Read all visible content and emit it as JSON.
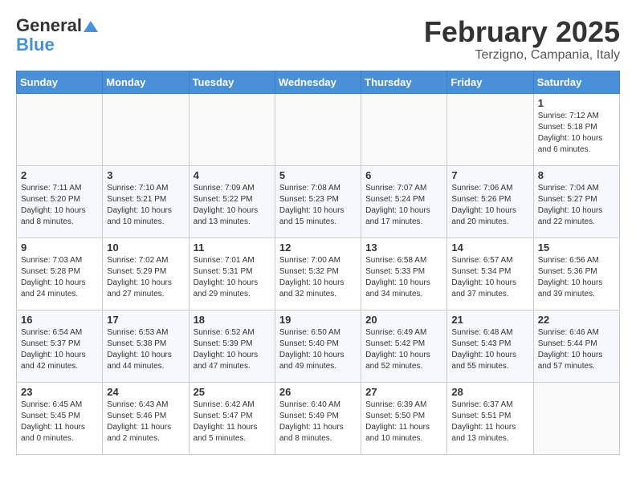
{
  "header": {
    "logo_line1": "General",
    "logo_line2": "Blue",
    "month": "February 2025",
    "location": "Terzigno, Campania, Italy"
  },
  "days_of_week": [
    "Sunday",
    "Monday",
    "Tuesday",
    "Wednesday",
    "Thursday",
    "Friday",
    "Saturday"
  ],
  "weeks": [
    [
      {
        "day": "",
        "info": ""
      },
      {
        "day": "",
        "info": ""
      },
      {
        "day": "",
        "info": ""
      },
      {
        "day": "",
        "info": ""
      },
      {
        "day": "",
        "info": ""
      },
      {
        "day": "",
        "info": ""
      },
      {
        "day": "1",
        "info": "Sunrise: 7:12 AM\nSunset: 5:18 PM\nDaylight: 10 hours and 6 minutes."
      }
    ],
    [
      {
        "day": "2",
        "info": "Sunrise: 7:11 AM\nSunset: 5:20 PM\nDaylight: 10 hours and 8 minutes."
      },
      {
        "day": "3",
        "info": "Sunrise: 7:10 AM\nSunset: 5:21 PM\nDaylight: 10 hours and 10 minutes."
      },
      {
        "day": "4",
        "info": "Sunrise: 7:09 AM\nSunset: 5:22 PM\nDaylight: 10 hours and 13 minutes."
      },
      {
        "day": "5",
        "info": "Sunrise: 7:08 AM\nSunset: 5:23 PM\nDaylight: 10 hours and 15 minutes."
      },
      {
        "day": "6",
        "info": "Sunrise: 7:07 AM\nSunset: 5:24 PM\nDaylight: 10 hours and 17 minutes."
      },
      {
        "day": "7",
        "info": "Sunrise: 7:06 AM\nSunset: 5:26 PM\nDaylight: 10 hours and 20 minutes."
      },
      {
        "day": "8",
        "info": "Sunrise: 7:04 AM\nSunset: 5:27 PM\nDaylight: 10 hours and 22 minutes."
      }
    ],
    [
      {
        "day": "9",
        "info": "Sunrise: 7:03 AM\nSunset: 5:28 PM\nDaylight: 10 hours and 24 minutes."
      },
      {
        "day": "10",
        "info": "Sunrise: 7:02 AM\nSunset: 5:29 PM\nDaylight: 10 hours and 27 minutes."
      },
      {
        "day": "11",
        "info": "Sunrise: 7:01 AM\nSunset: 5:31 PM\nDaylight: 10 hours and 29 minutes."
      },
      {
        "day": "12",
        "info": "Sunrise: 7:00 AM\nSunset: 5:32 PM\nDaylight: 10 hours and 32 minutes."
      },
      {
        "day": "13",
        "info": "Sunrise: 6:58 AM\nSunset: 5:33 PM\nDaylight: 10 hours and 34 minutes."
      },
      {
        "day": "14",
        "info": "Sunrise: 6:57 AM\nSunset: 5:34 PM\nDaylight: 10 hours and 37 minutes."
      },
      {
        "day": "15",
        "info": "Sunrise: 6:56 AM\nSunset: 5:36 PM\nDaylight: 10 hours and 39 minutes."
      }
    ],
    [
      {
        "day": "16",
        "info": "Sunrise: 6:54 AM\nSunset: 5:37 PM\nDaylight: 10 hours and 42 minutes."
      },
      {
        "day": "17",
        "info": "Sunrise: 6:53 AM\nSunset: 5:38 PM\nDaylight: 10 hours and 44 minutes."
      },
      {
        "day": "18",
        "info": "Sunrise: 6:52 AM\nSunset: 5:39 PM\nDaylight: 10 hours and 47 minutes."
      },
      {
        "day": "19",
        "info": "Sunrise: 6:50 AM\nSunset: 5:40 PM\nDaylight: 10 hours and 49 minutes."
      },
      {
        "day": "20",
        "info": "Sunrise: 6:49 AM\nSunset: 5:42 PM\nDaylight: 10 hours and 52 minutes."
      },
      {
        "day": "21",
        "info": "Sunrise: 6:48 AM\nSunset: 5:43 PM\nDaylight: 10 hours and 55 minutes."
      },
      {
        "day": "22",
        "info": "Sunrise: 6:46 AM\nSunset: 5:44 PM\nDaylight: 10 hours and 57 minutes."
      }
    ],
    [
      {
        "day": "23",
        "info": "Sunrise: 6:45 AM\nSunset: 5:45 PM\nDaylight: 11 hours and 0 minutes."
      },
      {
        "day": "24",
        "info": "Sunrise: 6:43 AM\nSunset: 5:46 PM\nDaylight: 11 hours and 2 minutes."
      },
      {
        "day": "25",
        "info": "Sunrise: 6:42 AM\nSunset: 5:47 PM\nDaylight: 11 hours and 5 minutes."
      },
      {
        "day": "26",
        "info": "Sunrise: 6:40 AM\nSunset: 5:49 PM\nDaylight: 11 hours and 8 minutes."
      },
      {
        "day": "27",
        "info": "Sunrise: 6:39 AM\nSunset: 5:50 PM\nDaylight: 11 hours and 10 minutes."
      },
      {
        "day": "28",
        "info": "Sunrise: 6:37 AM\nSunset: 5:51 PM\nDaylight: 11 hours and 13 minutes."
      },
      {
        "day": "",
        "info": ""
      }
    ]
  ]
}
